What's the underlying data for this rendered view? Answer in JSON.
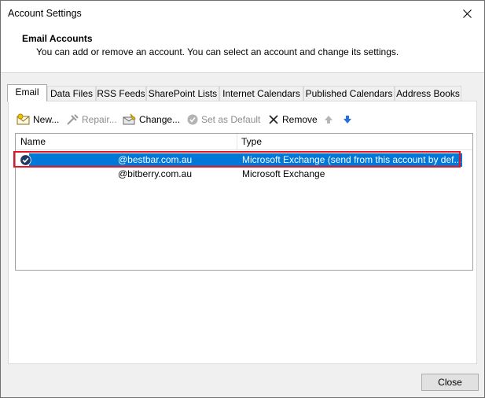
{
  "window": {
    "title": "Account Settings"
  },
  "header": {
    "title": "Email Accounts",
    "subtitle": "You can add or remove an account. You can select an account and change its settings."
  },
  "tabs": [
    {
      "label": "Email",
      "active": true
    },
    {
      "label": "Data Files"
    },
    {
      "label": "RSS Feeds"
    },
    {
      "label": "SharePoint Lists"
    },
    {
      "label": "Internet Calendars"
    },
    {
      "label": "Published Calendars"
    },
    {
      "label": "Address Books"
    }
  ],
  "toolbar": {
    "new_label": "New...",
    "repair_label": "Repair...",
    "change_label": "Change...",
    "set_default_label": "Set as Default",
    "remove_label": "Remove"
  },
  "list": {
    "columns": [
      "Name",
      "Type"
    ],
    "rows": [
      {
        "name": "@bestbar.com.au",
        "type": "Microsoft Exchange (send from this account by def...",
        "default": true
      },
      {
        "name": "@bitberry.com.au",
        "type": "Microsoft Exchange",
        "default": false
      }
    ]
  },
  "footer": {
    "close_label": "Close"
  },
  "colors": {
    "selection": "#0078d7",
    "highlight_box": "#e81123"
  }
}
